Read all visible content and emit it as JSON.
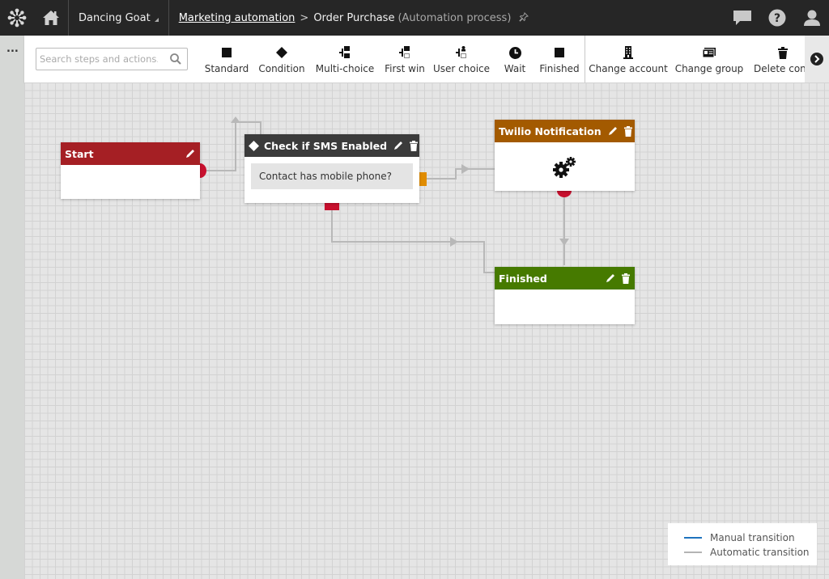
{
  "header": {
    "site_name": "Dancing Goat",
    "breadcrumb": {
      "parent": "Marketing automation",
      "separator": ">",
      "current": "Order Purchase",
      "current_type": "(Automation process)"
    },
    "icons": [
      "kentico-logo-icon",
      "home-icon",
      "pin-icon",
      "chat-icon",
      "help-icon",
      "user-icon"
    ]
  },
  "left_strip": {
    "menu_label": "..."
  },
  "toolbar": {
    "search_placeholder": "Search steps and actions.",
    "steps": [
      {
        "label": "Standard",
        "icon": "square-icon"
      },
      {
        "label": "Condition",
        "icon": "diamond-icon"
      },
      {
        "label": "Multi-choice",
        "icon": "multi-choice-icon"
      },
      {
        "label": "First win",
        "icon": "first-win-icon"
      },
      {
        "label": "User choice",
        "icon": "user-choice-icon"
      },
      {
        "label": "Wait",
        "icon": "clock-icon"
      },
      {
        "label": "Finished",
        "icon": "square-icon"
      }
    ],
    "actions": [
      {
        "label": "Change account",
        "icon": "building-icon"
      },
      {
        "label": "Change group",
        "icon": "group-card-icon"
      },
      {
        "label": "Delete cont",
        "icon": "trash-icon"
      }
    ],
    "more_icon": "chevron-right-circle-icon"
  },
  "nodes": {
    "start": {
      "title": "Start",
      "color": "#a51f24"
    },
    "check_sms": {
      "title": "Check if SMS Enabled",
      "color": "#3b3b3b",
      "condition": "Contact has mobile phone?"
    },
    "twilio": {
      "title": "Twilio Notification",
      "color": "#a35a00",
      "icon": "gears-icon"
    },
    "finished": {
      "title": "Finished",
      "color": "#467a00"
    }
  },
  "legend": {
    "manual": {
      "label": "Manual transition",
      "color": "#1e73be"
    },
    "automatic": {
      "label": "Automatic transition",
      "color": "#b4b4b4"
    }
  }
}
